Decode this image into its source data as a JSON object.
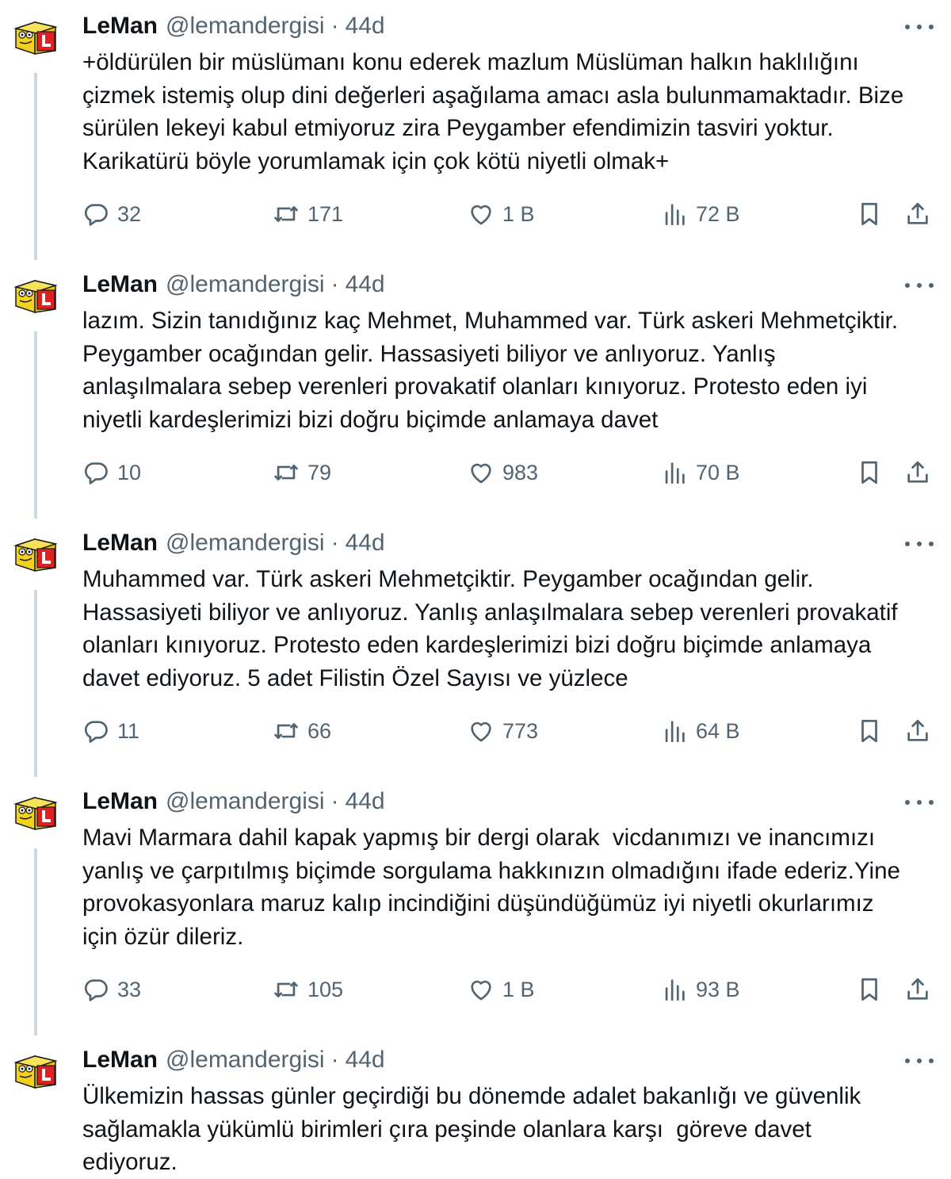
{
  "tweets": [
    {
      "name": "LeMan",
      "handle": "@lemandergisi",
      "separator": "·",
      "time": "44d",
      "text": "+öldürülen bir müslümanı konu ederek mazlum Müslüman halkın haklılığını\nçizmek istemiş olup dini değerleri aşağılama amacı asla bulunmamaktadır. Bize\nsürülen lekeyi kabul etmiyoruz zira Peygamber efendimizin tasviri yoktur.\nKarikatürü böyle yorumlamak için çok kötü niyetli olmak+",
      "replies": "32",
      "reposts": "171",
      "likes": "1 B",
      "views": "72 B"
    },
    {
      "name": "LeMan",
      "handle": "@lemandergisi",
      "separator": "·",
      "time": "44d",
      "text": "lazım. Sizin tanıdığınız kaç Mehmet, Muhammed var. Türk askeri Mehmetçiktir.\nPeygamber ocağından gelir. Hassasiyeti biliyor ve anlıyoruz. Yanlış\nanlaşılmalara sebep verenleri provakatif olanları kınıyoruz. Protesto eden iyi\nniyetli kardeşlerimizi bizi doğru biçimde anlamaya davet",
      "replies": "10",
      "reposts": "79",
      "likes": "983",
      "views": "70 B"
    },
    {
      "name": "LeMan",
      "handle": "@lemandergisi",
      "separator": "·",
      "time": "44d",
      "text": "Muhammed var. Türk askeri Mehmetçiktir. Peygamber ocağından gelir.\nHassasiyeti biliyor ve anlıyoruz. Yanlış anlaşılmalara sebep verenleri provakatif\nolanları kınıyoruz. Protesto eden kardeşlerimizi bizi doğru biçimde anlamaya\ndavet ediyoruz. 5 adet Filistin Özel Sayısı ve yüzlece",
      "replies": "11",
      "reposts": "66",
      "likes": "773",
      "views": "64 B"
    },
    {
      "name": "LeMan",
      "handle": "@lemandergisi",
      "separator": "·",
      "time": "44d",
      "text": "Mavi Marmara dahil kapak yapmış bir dergi olarak  vicdanımızı ve inancımızı\nyanlış ve çarpıtılmış biçimde sorgulama hakkınızın olmadığını ifade ederiz.Yine\nprovokasyonlara maruz kalıp incindiğini düşündüğümüz iyi niyetli okurlarımız\niçin özür dileriz.",
      "replies": "33",
      "reposts": "105",
      "likes": "1 B",
      "views": "93 B"
    },
    {
      "name": "LeMan",
      "handle": "@lemandergisi",
      "separator": "·",
      "time": "44d",
      "text": "Ülkemizin hassas günler geçirdiği bu dönemde adalet bakanlığı ve güvenlik\nsağlamakla yükümlü birimleri çıra peşinde olanlara karşı  göreve davet\nediyoruz."
    }
  ],
  "icons": {
    "avatar": "leman-logo",
    "more": "more-dots-icon",
    "reply": "reply-icon",
    "repost": "repost-icon",
    "like": "heart-icon",
    "views": "views-chart-icon",
    "bookmark": "bookmark-icon",
    "share": "share-icon"
  },
  "colors": {
    "text": "#0f1419",
    "secondary": "#536471",
    "thread_line": "#cfd9de",
    "logo_yellow": "#f2d21a",
    "logo_red": "#e02020"
  }
}
